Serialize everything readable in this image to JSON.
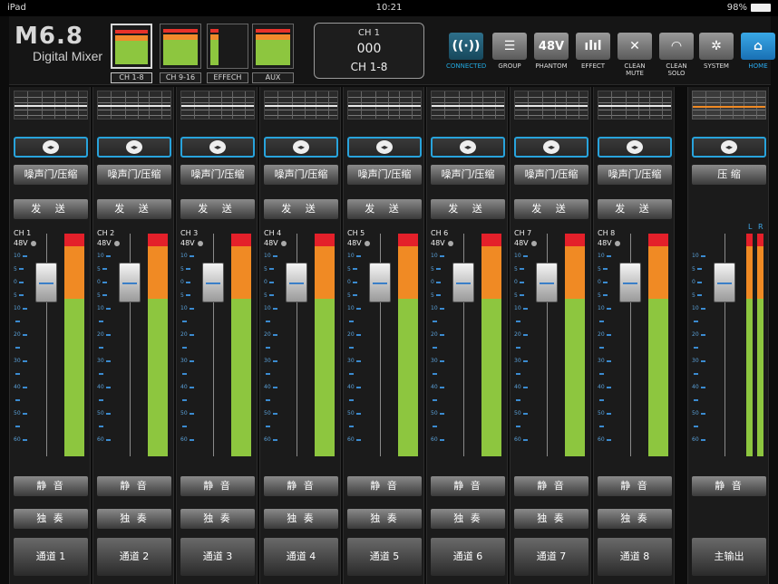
{
  "status_bar": {
    "device": "iPad",
    "time": "10:21",
    "battery": "98%"
  },
  "header": {
    "logo_main": "M6.8",
    "logo_sub": "Digital Mixer",
    "banks": [
      {
        "label": "CH 1-8",
        "active": true
      },
      {
        "label": "CH 9-16",
        "active": false
      },
      {
        "label": "EFFECH",
        "active": false
      },
      {
        "label": "AUX",
        "active": false
      }
    ],
    "display": {
      "line1": "CH 1",
      "line2": "000",
      "line3": "CH 1-8"
    },
    "toolbar": [
      {
        "label": "CONNECTED",
        "icon": "wifi-icon",
        "glyph": "((·))"
      },
      {
        "label": "GROUP",
        "icon": "group-icon",
        "glyph": "☰"
      },
      {
        "label": "PHANTOM",
        "icon": "phantom-48v-icon",
        "glyph": "48V"
      },
      {
        "label": "EFFECT",
        "icon": "effect-icon",
        "glyph": "ılıl"
      },
      {
        "label": "CLEAN MUTE",
        "icon": "clean-mute-icon",
        "glyph": "✕"
      },
      {
        "label": "CLEAN SOLO",
        "icon": "clean-solo-icon",
        "glyph": "◠"
      },
      {
        "label": "SYSTEM",
        "icon": "gear-icon",
        "glyph": "✲"
      },
      {
        "label": "HOME",
        "icon": "home-icon",
        "glyph": "⌂"
      }
    ]
  },
  "scale_labels": [
    "10",
    "5",
    "0",
    "5",
    "10",
    "",
    "20",
    "",
    "30",
    "",
    "40",
    "",
    "50",
    "",
    "60"
  ],
  "pan_glyph": "◂▸",
  "channels": [
    {
      "ch": "CH 1",
      "phantom": "48V",
      "gate": "噪声门/压缩",
      "send": "发 送",
      "mute": "静 音",
      "solo": "独 奏",
      "name": "通道 1"
    },
    {
      "ch": "CH 2",
      "phantom": "48V",
      "gate": "噪声门/压缩",
      "send": "发 送",
      "mute": "静 音",
      "solo": "独 奏",
      "name": "通道 2"
    },
    {
      "ch": "CH 3",
      "phantom": "48V",
      "gate": "噪声门/压缩",
      "send": "发 送",
      "mute": "静 音",
      "solo": "独 奏",
      "name": "通道 3"
    },
    {
      "ch": "CH 4",
      "phantom": "48V",
      "gate": "噪声门/压缩",
      "send": "发 送",
      "mute": "静 音",
      "solo": "独 奏",
      "name": "通道 4"
    },
    {
      "ch": "CH 5",
      "phantom": "48V",
      "gate": "噪声门/压缩",
      "send": "发 送",
      "mute": "静 音",
      "solo": "独 奏",
      "name": "通道 5"
    },
    {
      "ch": "CH 6",
      "phantom": "48V",
      "gate": "噪声门/压缩",
      "send": "发 送",
      "mute": "静 音",
      "solo": "独 奏",
      "name": "通道 6"
    },
    {
      "ch": "CH 7",
      "phantom": "48V",
      "gate": "噪声门/压缩",
      "send": "发 送",
      "mute": "静 音",
      "solo": "独 奏",
      "name": "通道 7"
    },
    {
      "ch": "CH 8",
      "phantom": "48V",
      "gate": "噪声门/压缩",
      "send": "发 送",
      "mute": "静 音",
      "solo": "独 奏",
      "name": "通道 8"
    }
  ],
  "master": {
    "comp": "压 缩",
    "left": "L",
    "right": "R",
    "mute": "静 音",
    "name": "主输出"
  },
  "colors": {
    "accent": "#28a3dc",
    "meter_red": "#e4202a",
    "meter_orange": "#f08a24",
    "meter_green": "#8dc63f"
  }
}
